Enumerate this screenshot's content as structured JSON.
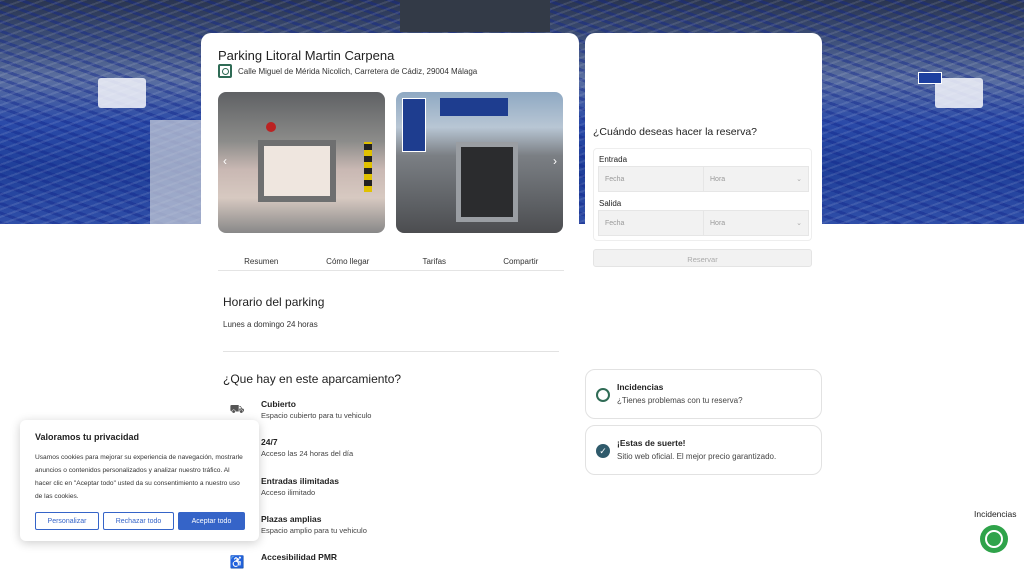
{
  "parking": {
    "title": "Parking Litoral Martin Carpena",
    "address": "Calle Miguel de Mérida Nicolich, Carretera de Cádiz, 29004 Málaga",
    "tabs": [
      "Resumen",
      "Cómo llegar",
      "Tarifas",
      "Compartir"
    ],
    "hours_title": "Horario del parking",
    "hours_text": "Lunes a domingo 24 horas",
    "features_title": "¿Que hay en este aparcamiento?",
    "features": [
      {
        "title": "Cubierto",
        "subtitle": "Espacio cubierto para tu vehiculo",
        "icon": "covered-car-icon"
      },
      {
        "title": "24/7",
        "subtitle": "Acceso las 24 horas del día",
        "icon": "clock-icon"
      },
      {
        "title": "Entradas ilimitadas",
        "subtitle": "Acceso ilimitado",
        "icon": "infinity-icon"
      },
      {
        "title": "Plazas amplias",
        "subtitle": "Espacio amplio para tu vehiculo",
        "icon": "wide-space-icon"
      },
      {
        "title": "Accesibilidad PMR",
        "subtitle": "",
        "icon": "wheelchair-icon"
      }
    ]
  },
  "booking": {
    "question": "¿Cuándo deseas hacer la reserva?",
    "entry_label": "Entrada",
    "exit_label": "Salida",
    "date_placeholder": "Fecha",
    "time_placeholder": "Hora",
    "reserve_label": "Reservar"
  },
  "support": {
    "title": "Incidencias",
    "subtitle": "¿Tienes problemas con tu reserva?"
  },
  "luck": {
    "title": "¡Estas de suerte!",
    "subtitle": "Sitio web oficial. El mejor precio garantizado."
  },
  "cookies": {
    "title": "Valoramos tu privacidad",
    "body": "Usamos cookies para mejorar su experiencia de navegación, mostrarle anuncios o contenidos personalizados y analizar nuestro tráfico. Al hacer clic en \"Aceptar todo\" usted da su consentimiento a nuestro uso de las cookies.",
    "customize": "Personalizar",
    "reject": "Rechazar todo",
    "accept": "Aceptar todo"
  },
  "whatsapp": {
    "label": "Incidencias"
  },
  "colors": {
    "accent": "#3564c8",
    "green": "#2f6b55",
    "whatsapp": "#2fa34a"
  }
}
